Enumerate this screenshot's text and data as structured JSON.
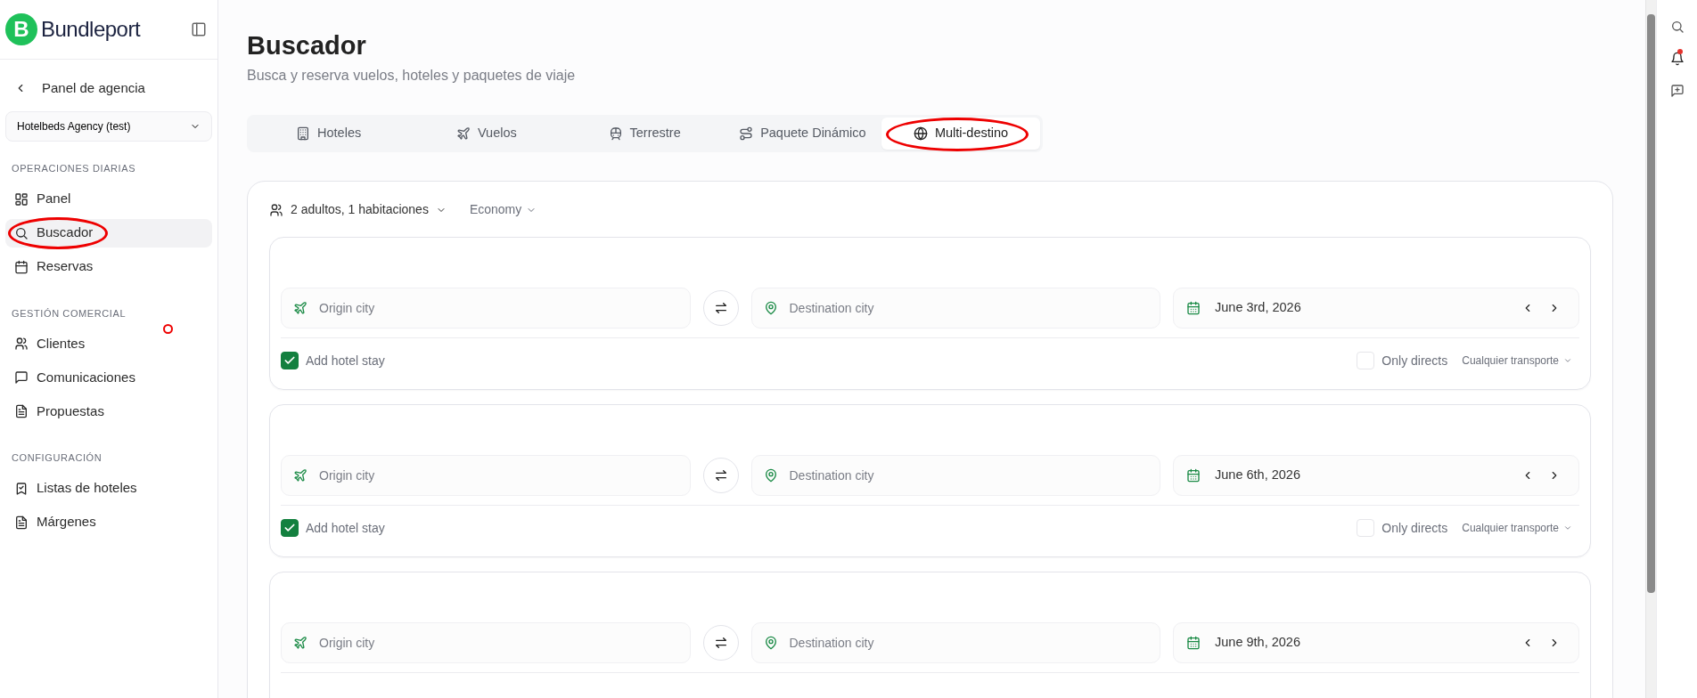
{
  "logo": {
    "mark": "B",
    "name": "Bundleport"
  },
  "back_link": "Panel de agencia",
  "agency_select": {
    "value": "Hotelbeds Agency (test)"
  },
  "sidebar": {
    "sections": [
      {
        "title": "OPERACIONES DIARIAS",
        "items": [
          {
            "label": "Panel",
            "selected": false,
            "circled": false
          },
          {
            "label": "Buscador",
            "selected": true,
            "circled": true
          },
          {
            "label": "Reservas",
            "selected": false,
            "circled": false
          }
        ]
      },
      {
        "title": "GESTIÓN COMERCIAL",
        "items": [
          {
            "label": "Clientes",
            "selected": false,
            "circled": false
          },
          {
            "label": "Comunicaciones",
            "selected": false,
            "circled": false
          },
          {
            "label": "Propuestas",
            "selected": false,
            "circled": false
          }
        ]
      },
      {
        "title": "CONFIGURACIÓN",
        "items": [
          {
            "label": "Listas de hoteles",
            "selected": false,
            "circled": false
          },
          {
            "label": "Márgenes",
            "selected": false,
            "circled": false
          }
        ]
      }
    ]
  },
  "click_marker": true,
  "page": {
    "title": "Buscador",
    "subtitle": "Busca y reserva vuelos, hoteles y paquetes de viaje"
  },
  "tabs": [
    {
      "label": "Hoteles",
      "selected": false,
      "circled": false
    },
    {
      "label": "Vuelos",
      "selected": false,
      "circled": false
    },
    {
      "label": "Terrestre",
      "selected": false,
      "circled": false
    },
    {
      "label": "Paquete Dinámico",
      "selected": false,
      "circled": false
    },
    {
      "label": "Multi-destino",
      "selected": true,
      "circled": true
    }
  ],
  "search": {
    "passengers": "2 adultos, 1 habitaciones",
    "cabin": "Economy",
    "legs": [
      {
        "origin_placeholder": "Origin city",
        "destination_placeholder": "Destination city",
        "date": "June 3rd, 2026",
        "add_hotel": {
          "label": "Add hotel stay",
          "checked": true
        },
        "only_directs": {
          "label": "Only directs",
          "checked": false
        },
        "transport": "Cualquier transporte"
      },
      {
        "origin_placeholder": "Origin city",
        "destination_placeholder": "Destination city",
        "date": "June 6th, 2026",
        "add_hotel": {
          "label": "Add hotel stay",
          "checked": true
        },
        "only_directs": {
          "label": "Only directs",
          "checked": false
        },
        "transport": "Cualquier transporte"
      },
      {
        "origin_placeholder": "Origin city",
        "destination_placeholder": "Destination city",
        "date": "June 9th, 2026"
      }
    ]
  }
}
